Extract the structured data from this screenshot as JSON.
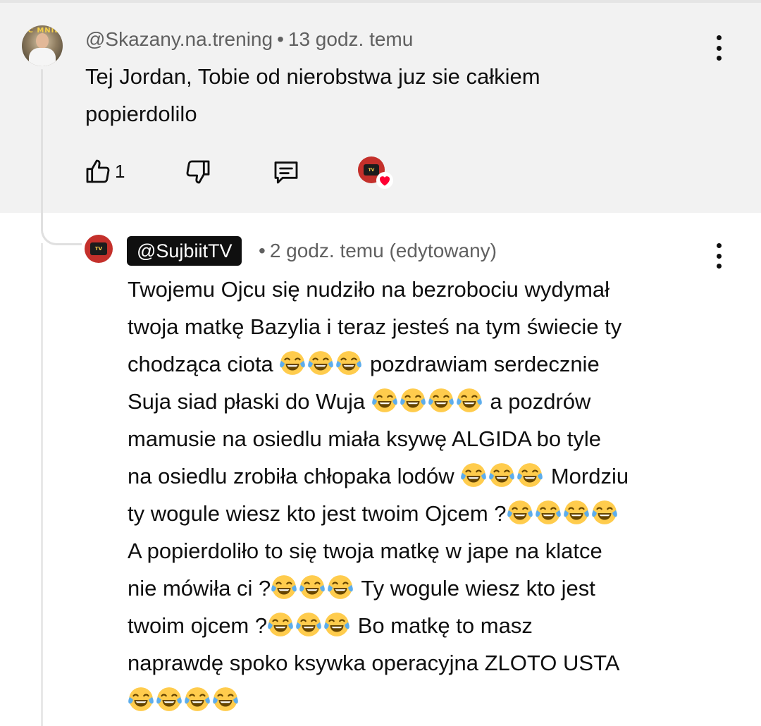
{
  "parent": {
    "author": "@Skazany.na.trening",
    "separator": "•",
    "time": "13 godz. temu",
    "text_line1": "Tej Jordan, Tobie od nierobstwa juz sie całkiem",
    "text_line2": "popierdolilo",
    "like_count": "1",
    "icons": [
      "thumbs-up-icon",
      "thumbs-down-icon",
      "reply-icon",
      "creator-heart-icon",
      "more-vert-icon"
    ]
  },
  "reply": {
    "author": "@SujbiitTV",
    "separator": "•",
    "time": "2 godz. temu (edytowany)",
    "lines": [
      "Twojemu Ojcu się nudziło na bezrobociu  wydymał",
      "twoja matkę Bazylia i teraz jesteś na tym świecie ty",
      "chodząca ciota ",
      " pozdrawiam  serdecznie",
      "Suja siad płaski do Wuja ",
      " a pozdrów",
      "mamusie na osiedlu miała ksywę ALGIDA bo tyle",
      "na osiedlu zrobiła chłopaka lodów ",
      " Mordziu",
      "ty wogule wiesz kto jest twoim Ojcem ?",
      "A popierdoliło to się twoja matkę w jape na klatce",
      "nie mówiła ci ?",
      " Ty wogule wiesz kto jest",
      "twoim ojcem ?",
      " Bo matkę to masz",
      "naprawdę spoko ksywka operacyjna ZLOTO USTA"
    ],
    "emoji_name": "face-with-tears-of-joy-icon"
  }
}
